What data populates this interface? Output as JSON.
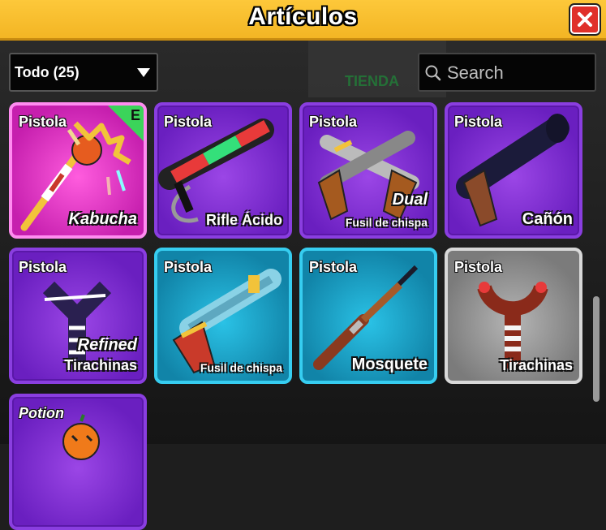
{
  "header": {
    "title": "Artículos",
    "close_icon": "close-icon"
  },
  "filter": {
    "selected": "Todo (25)"
  },
  "search": {
    "placeholder": "Search",
    "value": ""
  },
  "background": {
    "sign_text": "TIENDA"
  },
  "items": [
    {
      "type": "Pistola",
      "name": "Kabucha",
      "variant": "",
      "rarity_color": "#c61fae",
      "equipped_badge": "E"
    },
    {
      "type": "Pistola",
      "name": "Rifle Ácido",
      "variant": "",
      "rarity_color": "#6a1fc0"
    },
    {
      "type": "Pistola",
      "name": "Fusil de chispa",
      "variant": "Dual",
      "rarity_color": "#6a1fc0"
    },
    {
      "type": "Pistola",
      "name": "Cañón",
      "variant": "",
      "rarity_color": "#6a1fc0"
    },
    {
      "type": "Pistola",
      "name": "Tirachinas",
      "variant": "Refined",
      "rarity_color": "#6a1fc0"
    },
    {
      "type": "Pistola",
      "name": "Fusil de chispa",
      "variant": "",
      "rarity_color": "#1184a8"
    },
    {
      "type": "Pistola",
      "name": "Mosquete",
      "variant": "",
      "rarity_color": "#1184a8"
    },
    {
      "type": "Pistola",
      "name": "Tirachinas",
      "variant": "",
      "rarity_color": "#7b7b7b"
    },
    {
      "type": "Potion",
      "name": "",
      "variant": "",
      "rarity_color": "#6a1fc0"
    }
  ]
}
